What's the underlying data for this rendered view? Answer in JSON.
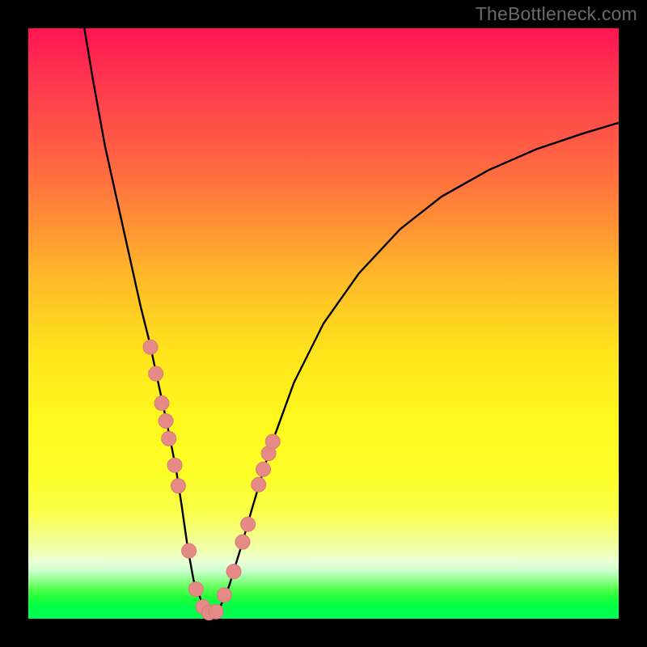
{
  "watermark": "TheBottleneck.com",
  "colors": {
    "frame": "#000000",
    "curve": "#000000",
    "marker_fill": "#e58a87",
    "marker_stroke": "#d97b77"
  },
  "chart_data": {
    "type": "line",
    "title": "",
    "xlabel": "",
    "ylabel": "",
    "xlim": [
      0,
      100
    ],
    "ylim": [
      0,
      100
    ],
    "curve": {
      "x": [
        9.5,
        11,
        13,
        15,
        17,
        19,
        20.5,
        22,
        23.5,
        25,
        26,
        27,
        28,
        29.5,
        31,
        32.5,
        34,
        36,
        38,
        41,
        45,
        50,
        56,
        63,
        70,
        78,
        86,
        94,
        100
      ],
      "y": [
        100,
        91,
        80,
        71,
        62,
        53,
        47,
        40,
        33,
        25.5,
        19,
        12,
        6.5,
        2.5,
        0.7,
        2,
        5.5,
        12,
        19,
        29,
        40,
        50,
        58.5,
        66,
        71.5,
        76,
        79.5,
        82.2,
        84
      ]
    },
    "markers": [
      {
        "x": 20.7,
        "y": 46.0
      },
      {
        "x": 21.6,
        "y": 41.5
      },
      {
        "x": 22.6,
        "y": 36.5
      },
      {
        "x": 23.3,
        "y": 33.5
      },
      {
        "x": 23.8,
        "y": 30.5
      },
      {
        "x": 24.8,
        "y": 26.0
      },
      {
        "x": 25.4,
        "y": 22.5
      },
      {
        "x": 27.2,
        "y": 11.5
      },
      {
        "x": 28.4,
        "y": 5.0
      },
      {
        "x": 29.6,
        "y": 2.0
      },
      {
        "x": 30.6,
        "y": 1.0
      },
      {
        "x": 31.8,
        "y": 1.2
      },
      {
        "x": 33.2,
        "y": 4.0
      },
      {
        "x": 34.8,
        "y": 8.0
      },
      {
        "x": 36.3,
        "y": 13.0
      },
      {
        "x": 37.2,
        "y": 16.0
      },
      {
        "x": 39.0,
        "y": 22.7
      },
      {
        "x": 39.8,
        "y": 25.3
      },
      {
        "x": 40.7,
        "y": 28.0
      },
      {
        "x": 41.4,
        "y": 30.0
      }
    ]
  }
}
